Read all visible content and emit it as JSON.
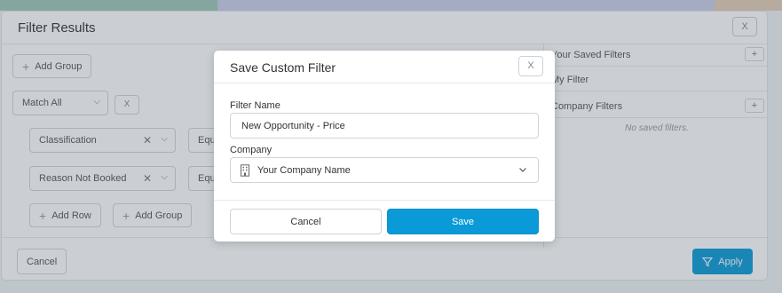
{
  "background_filter_modal": {
    "title": "Filter Results",
    "close_label": "X",
    "add_group_label": "Add Group",
    "match_select_value": "Match All",
    "remove_label": "X",
    "conditions": [
      {
        "field": "Classification",
        "operator": "Equ"
      },
      {
        "field": "Reason Not Booked",
        "operator": "Equ"
      }
    ],
    "add_row_label": "Add Row",
    "add_group_inner_label": "Add Group",
    "cancel_label": "Cancel",
    "apply_label": "Apply",
    "saved_panel": {
      "your_saved_filters": "Your Saved Filters",
      "my_filter": "My Filter",
      "company_filters": "Company Filters",
      "empty_text": "No saved filters."
    }
  },
  "dialog": {
    "title": "Save Custom Filter",
    "close_label": "X",
    "filter_name_label": "Filter Name",
    "filter_name_value": "New Opportunity - Price",
    "company_label": "Company",
    "company_value": "Your Company Name",
    "cancel_label": "Cancel",
    "save_label": "Save"
  },
  "colors": {
    "primary": "#0a9ad7",
    "overlay": "rgba(70,82,96,0.28)"
  },
  "icons": [
    "plus-icon",
    "chevron-down-icon",
    "close-icon",
    "building-icon",
    "filter-icon"
  ]
}
